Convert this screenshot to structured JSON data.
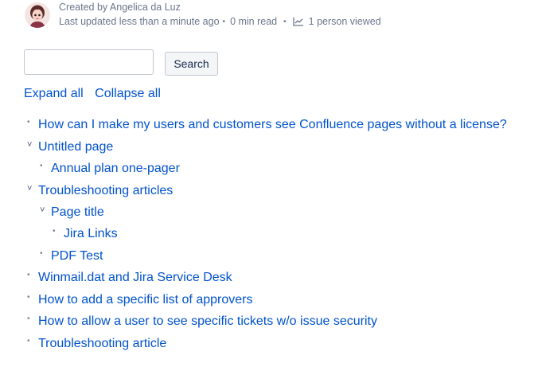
{
  "byline": {
    "author_text": "Created by Angelica da Luz",
    "updated_text": "Last updated less than a minute ago",
    "read_text": "0 min read",
    "views_text": "1 person viewed",
    "separator": "•"
  },
  "search": {
    "input_value": "",
    "button_label": "Search"
  },
  "tree_controls": {
    "expand_all": "Expand all",
    "collapse_all": "Collapse all"
  },
  "tree": {
    "marker_bullet": "•",
    "marker_expanded": "˅",
    "items": [
      {
        "label": "How can I make my users and customers see Confluence pages without a license?",
        "state": "leaf"
      },
      {
        "label": "Untitled page",
        "state": "expanded"
      },
      {
        "label": "Annual plan one-pager",
        "state": "leaf"
      },
      {
        "label": "Troubleshooting articles",
        "state": "expanded"
      },
      {
        "label": "Page title",
        "state": "expanded"
      },
      {
        "label": "Jira Links",
        "state": "leaf"
      },
      {
        "label": "PDF Test",
        "state": "leaf"
      },
      {
        "label": "Winmail.dat and Jira Service Desk",
        "state": "leaf"
      },
      {
        "label": "How to add a specific list of approvers",
        "state": "leaf"
      },
      {
        "label": "How to allow a user to see specific tickets w/o issue security",
        "state": "leaf"
      },
      {
        "label": "Troubleshooting article",
        "state": "leaf"
      }
    ]
  },
  "colors": {
    "link": "#0052CC",
    "meta_text": "#6B778C",
    "border": "#C1C7D0"
  }
}
